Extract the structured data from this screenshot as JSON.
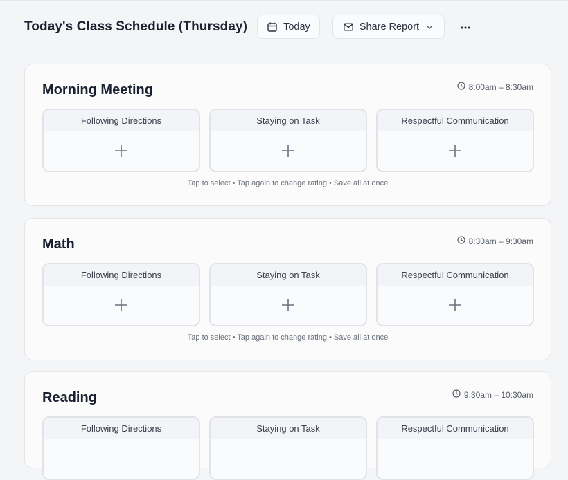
{
  "header": {
    "title": "Today's Class Schedule (Thursday)",
    "today_label": "Today",
    "share_label": "Share Report"
  },
  "criteria": [
    "Following Directions",
    "Staying on Task",
    "Respectful Communication"
  ],
  "hint": "Tap to select • Tap again to change rating • Save all at once",
  "periods": [
    {
      "name": "Morning Meeting",
      "time": "8:00am – 8:30am"
    },
    {
      "name": "Math",
      "time": "8:30am – 9:30am"
    },
    {
      "name": "Reading",
      "time": "9:30am – 10:30am"
    }
  ],
  "icons": {
    "today": "calendar-icon",
    "share": "mail-icon",
    "dropdown": "chevron-down-icon",
    "more": "more-horizontal-icon",
    "time": "clock-icon",
    "add": "plus-icon"
  },
  "colors": {
    "background": "#f4f5f7",
    "card": "#fbfbfc",
    "border": "#e4e6ea",
    "tile_header": "#f2f4f7",
    "text": "#1c2230",
    "muted": "#6a707b"
  }
}
